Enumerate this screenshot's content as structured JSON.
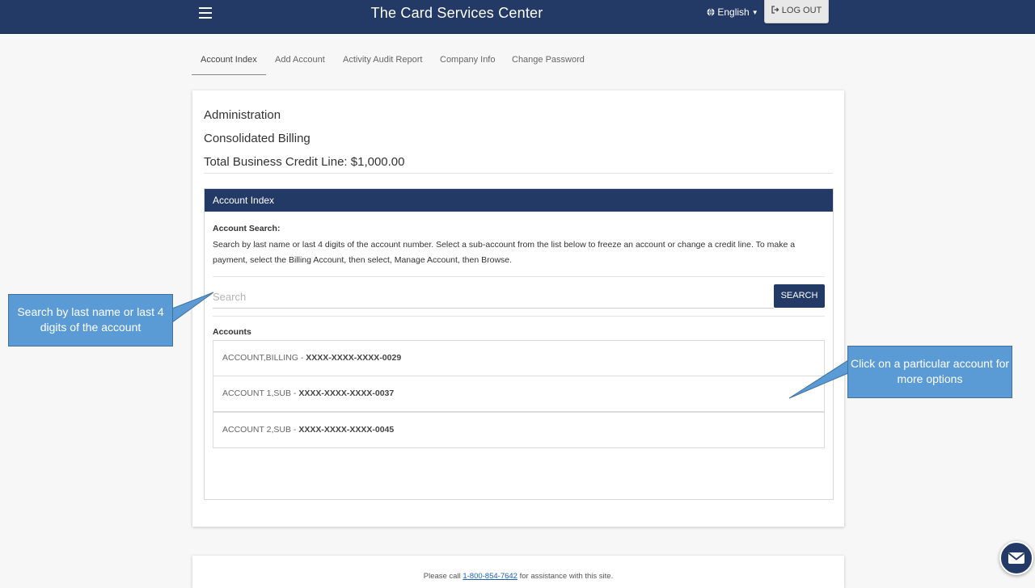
{
  "header": {
    "title": "The Card Services Center",
    "language": "English",
    "logout_label": "LOG OUT"
  },
  "tabs": [
    {
      "label": "Account Index",
      "active": true
    },
    {
      "label": "Add Account",
      "active": false
    },
    {
      "label": "Activity Audit Report",
      "active": false
    },
    {
      "label": "Company Info",
      "active": false
    },
    {
      "label": "Change Password",
      "active": false
    }
  ],
  "summary": {
    "role": "Administration",
    "billing_type": "Consolidated Billing",
    "credit_line": "Total Business Credit Line: $1,000.00"
  },
  "account_index": {
    "panel_title": "Account Index",
    "search_title": "Account Search:",
    "search_description": "Search by last name or last 4 digits of the account number. Select a sub-account from the list below to freeze an account or change a credit line. To make a payment, select the Billing Account, then select, Manage Account, then Browse.",
    "search_placeholder": "Search",
    "search_button": "SEARCH",
    "accounts_label": "Accounts",
    "accounts": [
      {
        "name": "ACCOUNT,BILLING - ",
        "number": "XXXX-XXXX-XXXX-0029"
      },
      {
        "name": "ACCOUNT 1,SUB - ",
        "number": "XXXX-XXXX-XXXX-0037"
      },
      {
        "name": "ACCOUNT 2,SUB - ",
        "number": "XXXX-XXXX-XXXX-0045"
      }
    ]
  },
  "callouts": {
    "search_tip": "Search by last name or last 4 digits of the account",
    "account_tip": "Click on a particular account for more options"
  },
  "footer": {
    "prefix": "Please call ",
    "phone": "1-800-854-7642",
    "suffix": " for assistance with this site."
  },
  "colors": {
    "brand_navy": "#233a66",
    "callout_blue": "#5b9bd5"
  },
  "icons": {
    "menu": "hamburger-icon",
    "language": "globe-icon",
    "logout": "logout-icon",
    "chat": "envelope-icon"
  }
}
